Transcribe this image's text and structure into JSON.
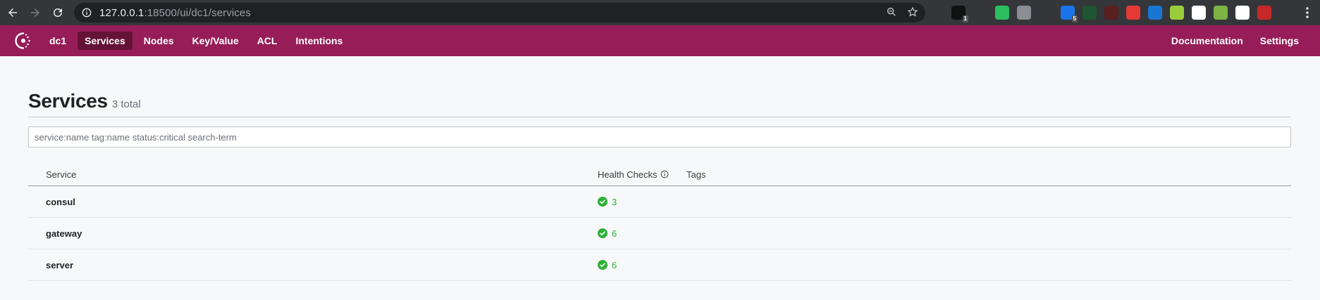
{
  "browser": {
    "url_host": "127.0.0.1",
    "url_rest": ":18500/ui/dc1/services",
    "extensions": [
      {
        "name": "ext-1",
        "color": "#111111",
        "badge": "1"
      },
      {
        "name": "ext-2",
        "color": "#35363a",
        "badge": ""
      },
      {
        "name": "evernote",
        "color": "#2dbe60",
        "badge": ""
      },
      {
        "name": "camera",
        "color": "#8a8d91",
        "badge": ""
      },
      {
        "name": "pen",
        "color": "#35363a",
        "badge": ""
      },
      {
        "name": "sync",
        "color": "#1a73e8",
        "badge": "5"
      },
      {
        "name": "ext-7",
        "color": "#1e5631",
        "badge": ""
      },
      {
        "name": "ext-8",
        "color": "#5a1f1f",
        "badge": ""
      },
      {
        "name": "stop",
        "color": "#e53935",
        "badge": ""
      },
      {
        "name": "s-ext",
        "color": "#1976d2",
        "badge": ""
      },
      {
        "name": "m-ext",
        "color": "#9ccc3c",
        "badge": ""
      },
      {
        "name": "eyes",
        "color": "#ffffff",
        "badge": ""
      },
      {
        "name": "puzzle",
        "color": "#7cb342",
        "badge": ""
      },
      {
        "name": "flag",
        "color": "#ffffff",
        "badge": ""
      },
      {
        "name": "avatar",
        "color": "#c62828",
        "badge": ""
      }
    ]
  },
  "header": {
    "brand_color": "#961d58",
    "nav_left": [
      {
        "label": "dc1",
        "name": "nav-dc1",
        "active": false
      },
      {
        "label": "Services",
        "name": "nav-services",
        "active": true
      },
      {
        "label": "Nodes",
        "name": "nav-nodes",
        "active": false
      },
      {
        "label": "Key/Value",
        "name": "nav-key-value",
        "active": false
      },
      {
        "label": "ACL",
        "name": "nav-acl",
        "active": false
      },
      {
        "label": "Intentions",
        "name": "nav-intentions",
        "active": false
      }
    ],
    "nav_right": [
      {
        "label": "Documentation",
        "name": "nav-documentation"
      },
      {
        "label": "Settings",
        "name": "nav-settings"
      }
    ]
  },
  "page": {
    "title": "Services",
    "count_label": "3 total",
    "search_placeholder": "service:name tag:name status:critical search-term"
  },
  "table": {
    "columns": {
      "service": "Service",
      "health": "Health Checks",
      "tags": "Tags"
    },
    "rows": [
      {
        "service": "consul",
        "passing": "3",
        "tags": ""
      },
      {
        "service": "gateway",
        "passing": "6",
        "tags": ""
      },
      {
        "service": "server",
        "passing": "6",
        "tags": ""
      }
    ],
    "ok_color": "#2eb039"
  }
}
